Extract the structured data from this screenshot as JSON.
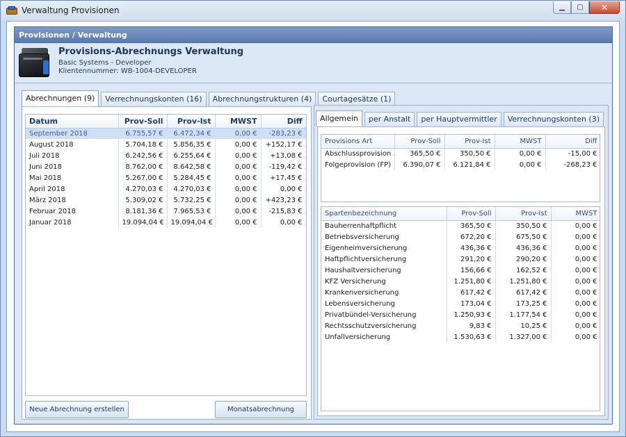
{
  "window": {
    "title": "Verwaltung Provisionen"
  },
  "header": {
    "section_title": "Provisionen / Verwaltung",
    "title": "Provisions-Abrechnungs Verwaltung",
    "subtitle": "Basic Systems - Developer",
    "client_label": "Klientennummer: WB-1004-DEVELOPER"
  },
  "left_tabs": [
    "Abrechnungen (9)",
    "Verrechnungskonten (16)",
    "Abrechnungstrukturen (4)",
    "Courtagesätze (1)"
  ],
  "abrechnungen": {
    "columns": [
      "Datum",
      "Prov-Soll",
      "Prov-Ist",
      "MWST",
      "Diff"
    ],
    "rows": [
      [
        "September 2018",
        "6.755,57 €",
        "6.472,34 €",
        "0,00 €",
        "-283,23 €"
      ],
      [
        "August 2018",
        "5.704,18 €",
        "5.856,35 €",
        "0,00 €",
        "+152,17 €"
      ],
      [
        "Juli 2018",
        "6.242,56 €",
        "6.255,64 €",
        "0,00 €",
        "+13,08 €"
      ],
      [
        "Juni 2018",
        "8.762,00 €",
        "8.642,58 €",
        "0,00 €",
        "-119,42 €"
      ],
      [
        "Mai 2018",
        "5.267,00 €",
        "5.284,45 €",
        "0,00 €",
        "+17,45 €"
      ],
      [
        "April 2018",
        "4.270,03 €",
        "4.270,03 €",
        "0,00 €",
        "0,00 €"
      ],
      [
        "März 2018",
        "5.309,02 €",
        "5.732,25 €",
        "0,00 €",
        "+423,23 €"
      ],
      [
        "Februar 2018",
        "8.181,36 €",
        "7.965,53 €",
        "0,00 €",
        "-215,83 €"
      ],
      [
        "Januar 2018",
        "19.094,04 €",
        "19.094,04 €",
        "0,00 €",
        "0,00 €"
      ]
    ],
    "selected_index": 0
  },
  "buttons": {
    "new_abrechnung": "Neue Abrechnung erstellen",
    "monatsabrechnung": "Monatsabrechnung"
  },
  "right_tabs": [
    "Allgemein",
    "per Anstalt",
    "per Hauptvermittler",
    "Verrechnungskonten (3)"
  ],
  "provisions_art": {
    "columns": [
      "Provisions Art",
      "Prov-Soll",
      "Prov-Ist",
      "MWST",
      "Diff"
    ],
    "rows": [
      [
        "Abschlussprovision ...",
        "365,50 €",
        "350,50 €",
        "0,00 €",
        "-15,00 €"
      ],
      [
        "Folgeprovision (FP)",
        "6.390,07 €",
        "6.121,84 €",
        "0,00 €",
        "-268,23 €"
      ]
    ]
  },
  "sparten": {
    "columns": [
      "Spartenbezeichnung",
      "Prov-Soll",
      "Prov-Ist",
      "MWST"
    ],
    "rows": [
      [
        "Bauherrenhaftpflicht",
        "365,50 €",
        "350,50 €",
        "0,00 €"
      ],
      [
        "Betriebsversicherung",
        "672,20 €",
        "675,50 €",
        "0,00 €"
      ],
      [
        "Eigenheimversicherung",
        "436,36 €",
        "436,36 €",
        "0,00 €"
      ],
      [
        "Haftpflichtversicherung",
        "291,20 €",
        "290,20 €",
        "0,00 €"
      ],
      [
        "Haushaltversicherung",
        "156,66 €",
        "162,52 €",
        "0,00 €"
      ],
      [
        "KFZ Versicherung",
        "1.251,80 €",
        "1.251,80 €",
        "0,00 €"
      ],
      [
        "Krankenversicherung",
        "617,42 €",
        "617,42 €",
        "0,00 €"
      ],
      [
        "Lebensversicherung",
        "173,04 €",
        "173,25 €",
        "0,00 €"
      ],
      [
        "Privatbündel-Versicherung",
        "1.250,93 €",
        "1.177,54 €",
        "0,00 €"
      ],
      [
        "Rechtsschutzversicherung",
        "9,83 €",
        "10,25 €",
        "0,00 €"
      ],
      [
        "Unfallversicherung",
        "1.530,63 €",
        "1.327,00 €",
        "0,00 €"
      ]
    ]
  }
}
